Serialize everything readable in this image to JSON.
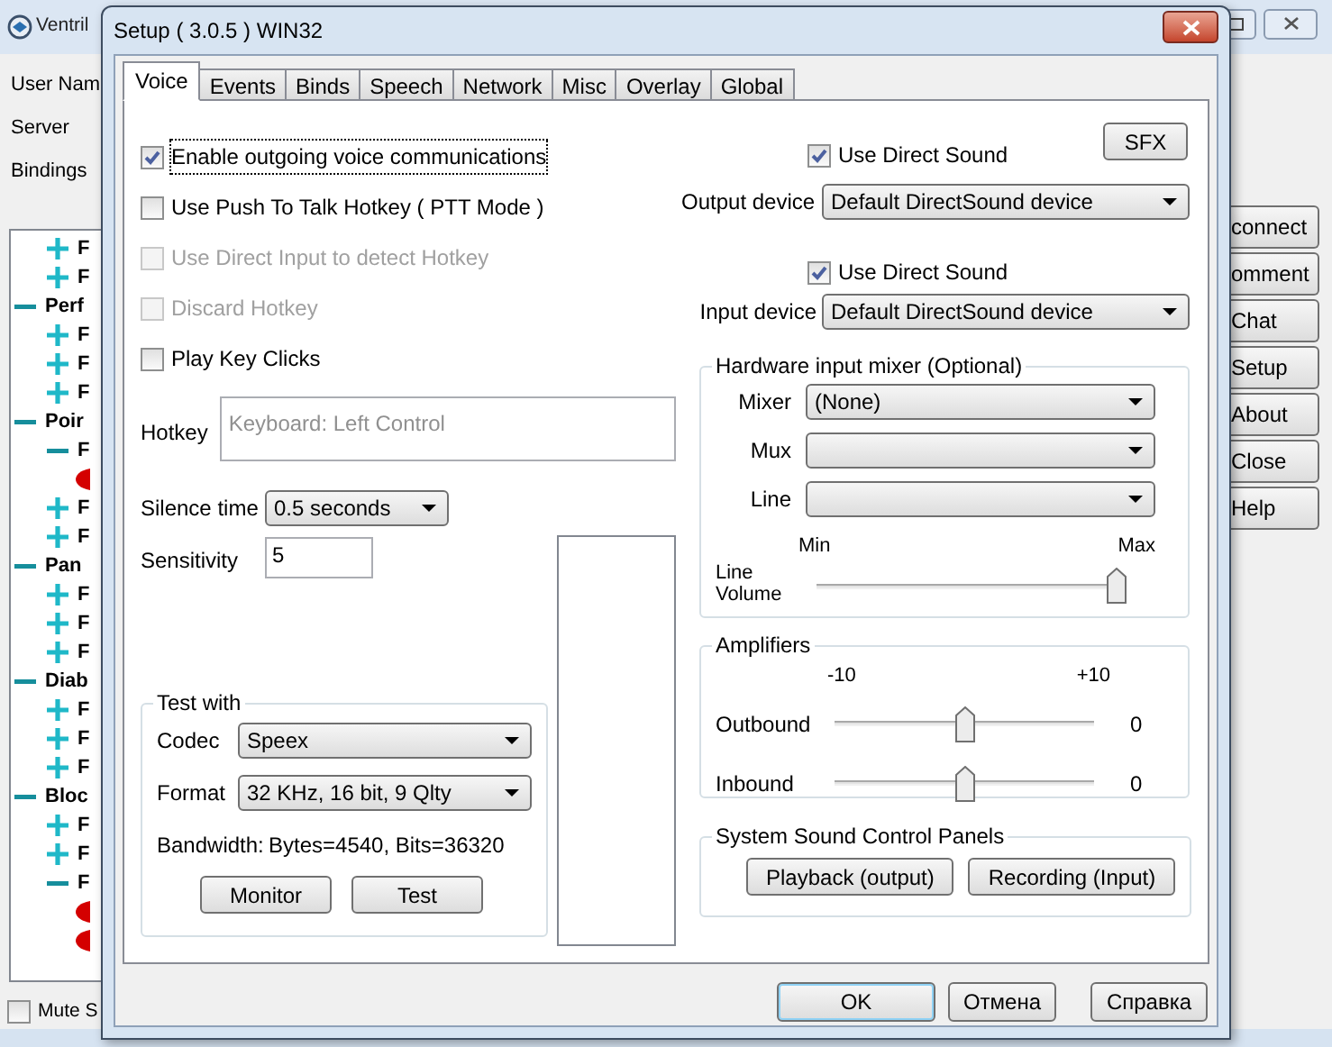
{
  "background_window": {
    "title": "Ventril",
    "labels": [
      "User Nam",
      "Server",
      "Bindings"
    ],
    "tree": {
      "leading": [
        {
          "label": "F",
          "expanded": false
        },
        {
          "label": "F",
          "expanded": false
        }
      ],
      "groups": [
        {
          "label": "Perf",
          "expanded": true,
          "children": [
            {
              "label": "F",
              "expanded": false
            },
            {
              "label": "F",
              "expanded": false
            },
            {
              "label": "F",
              "expanded": false
            }
          ]
        },
        {
          "label": "Poir",
          "expanded": true,
          "children": [
            {
              "label": "F",
              "expanded": true,
              "children": [
                {
                  "kind": "speaker"
                }
              ]
            },
            {
              "label": "F",
              "expanded": false
            },
            {
              "label": "F",
              "expanded": false
            }
          ]
        },
        {
          "label": "Pan",
          "expanded": true,
          "children": [
            {
              "label": "F",
              "expanded": false
            },
            {
              "label": "F",
              "expanded": false
            },
            {
              "label": "F",
              "expanded": false
            }
          ]
        },
        {
          "label": "Diab",
          "expanded": true,
          "children": [
            {
              "label": "F",
              "expanded": false
            },
            {
              "label": "F",
              "expanded": false
            },
            {
              "label": "F",
              "expanded": false
            }
          ]
        },
        {
          "label": "Bloc",
          "expanded": true,
          "children": [
            {
              "label": "F",
              "expanded": false
            },
            {
              "label": "F",
              "expanded": false
            },
            {
              "label": "F",
              "expanded": true,
              "children": [
                {
                  "kind": "speaker"
                },
                {
                  "kind": "speaker"
                }
              ]
            }
          ]
        }
      ]
    },
    "mute_checkbox": {
      "label": "Mute S",
      "checked": false
    },
    "buttons": [
      "connect",
      "omment",
      "Chat",
      "Setup",
      "About",
      "Close",
      "Help"
    ]
  },
  "dialog": {
    "title": "Setup ( 3.0.5 ) WIN32",
    "tabs": [
      {
        "label": "Voice",
        "selected": true
      },
      {
        "label": "Events",
        "selected": false
      },
      {
        "label": "Binds",
        "selected": false
      },
      {
        "label": "Speech",
        "selected": false
      },
      {
        "label": "Network",
        "selected": false
      },
      {
        "label": "Misc",
        "selected": false
      },
      {
        "label": "Overlay",
        "selected": false
      },
      {
        "label": "Global",
        "selected": false
      }
    ],
    "voice_options": [
      {
        "label": "Enable outgoing voice communications",
        "checked": true,
        "disabled": false,
        "focused": true
      },
      {
        "label": "Use Push To Talk Hotkey ( PTT Mode )",
        "checked": false,
        "disabled": false,
        "focused": false
      },
      {
        "label": "Use Direct Input to detect Hotkey",
        "checked": false,
        "disabled": true,
        "focused": false
      },
      {
        "label": "Discard Hotkey",
        "checked": false,
        "disabled": true,
        "focused": false
      },
      {
        "label": "Play Key Clicks",
        "checked": false,
        "disabled": false,
        "focused": false
      }
    ],
    "hotkey": {
      "label": "Hotkey",
      "value": "Keyboard: Left Control",
      "disabled": true
    },
    "silence_time": {
      "label": "Silence time",
      "value": "0.5 seconds"
    },
    "sensitivity": {
      "label": "Sensitivity",
      "value": "5"
    },
    "test_with": {
      "title": "Test with",
      "codec": {
        "label": "Codec",
        "value": "Speex"
      },
      "format": {
        "label": "Format",
        "value": "32 KHz, 16 bit, 9 Qlty"
      },
      "bandwidth_label": "Bandwidth:",
      "bandwidth_value": "Bytes=4540, Bits=36320",
      "buttons": [
        "Monitor",
        "Test"
      ]
    },
    "sfx_button": "SFX",
    "output": {
      "direct_sound": {
        "label": "Use Direct Sound",
        "checked": true
      },
      "label": "Output device",
      "value": "Default DirectSound device"
    },
    "input": {
      "direct_sound": {
        "label": "Use Direct Sound",
        "checked": true
      },
      "label": "Input device",
      "value": "Default DirectSound device"
    },
    "mixer": {
      "title": "Hardware input mixer (Optional)",
      "selects": [
        {
          "label": "Mixer",
          "value": "(None)"
        },
        {
          "label": "Mux"
        },
        {
          "label": "Line"
        }
      ],
      "min_label": "Min",
      "max_label": "Max",
      "volume_label": "Line Volume",
      "level": 1
    },
    "amplifiers": {
      "title": "Amplifiers",
      "min_label": "-10",
      "max_label": "+10",
      "sliders": [
        {
          "label": "Outbound",
          "level": 0.5,
          "reading": "0"
        },
        {
          "label": "Inbound",
          "level": 0.5,
          "reading": "0"
        }
      ]
    },
    "system_panels": {
      "title": "System Sound Control Panels",
      "buttons": [
        "Playback (output)",
        "Recording (Input)"
      ]
    },
    "footer_buttons": [
      {
        "label": "OK",
        "default": true
      },
      {
        "label": "Отмена",
        "default": false
      },
      {
        "label": "Справка",
        "default": false
      }
    ]
  }
}
